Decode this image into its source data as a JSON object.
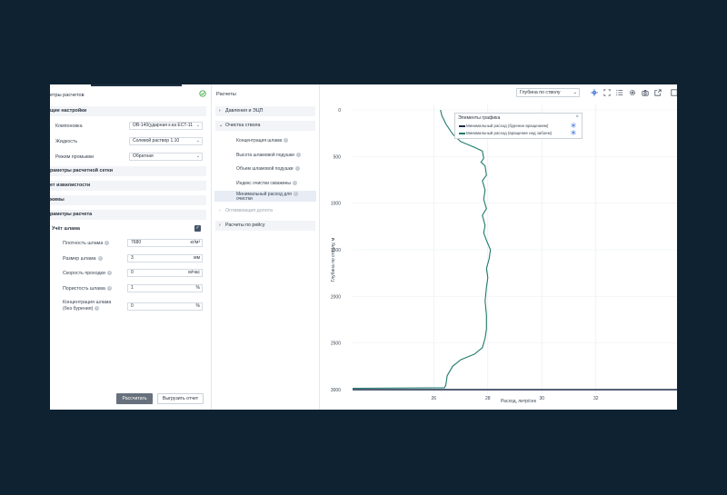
{
  "left_panel": {
    "title": "етры расчетов",
    "sections": {
      "general": "щие настройки",
      "grid": "раметры расчетной сетки",
      "tortuosity": "ет извилистости",
      "modes": "жимы",
      "calc_params": "раметры расчета"
    },
    "fields": {
      "layout_label": "Компоновка",
      "layout_value": "OB-140(ударная к.ка ECT-11",
      "fluid_label": "Жидкость",
      "fluid_value": "Солевой раствор 1.10",
      "flush_label": "Режим промывки",
      "flush_value": "Обратная"
    },
    "sludge": {
      "title": "Учёт шлама",
      "checked": true,
      "density_label": "Плотность шлама",
      "density_value": "7680",
      "density_unit": "кг/м³",
      "size_label": "Размер шлама",
      "size_value": "3",
      "size_unit": "мм",
      "speed_label": "Скорость проходки",
      "speed_value": "0",
      "speed_unit": "м/час",
      "porosity_label": "Пористость шлама",
      "porosity_value": "1",
      "porosity_unit": "%",
      "conc_label_1": "Концентрация шлама",
      "conc_label_2": "(без бурения)",
      "conc_value": "0",
      "conc_unit": "%"
    },
    "buttons": {
      "calculate": "Рассчитать",
      "export": "Выгрузить отчет"
    }
  },
  "middle_panel": {
    "title": "Расчеты",
    "groups": [
      {
        "label": "Давления и ЭЦП",
        "expanded": false
      },
      {
        "label": "Очистка ствола",
        "expanded": true
      },
      {
        "label": "Оптимизация долота",
        "expanded": false
      },
      {
        "label": "Расчеты по рейсу",
        "expanded": false
      }
    ],
    "subitems": [
      "Концентрация шлама",
      "Высота шламовой подушки",
      "Объем шламовой подушки",
      "Индекс очистки скважины"
    ],
    "selected_item_1": "Минимальный расход для",
    "selected_item_2": "очистки"
  },
  "chart_panel": {
    "dropdown": "Глубина по стволу",
    "toolbar_icons": [
      "crosshair-icon",
      "fullscreen-icon",
      "list-icon",
      "settings-icon",
      "camera-icon",
      "export-icon",
      "menu-icon"
    ],
    "legend": {
      "title": "Элементы графика",
      "items": [
        {
          "label": "Минимальный расход (бурение вращением)",
          "color": "#1d2c4a"
        },
        {
          "label": "Минимальный расход (вращение над забоем)",
          "color": "#1e7a6a"
        }
      ]
    }
  },
  "chart_data": {
    "type": "line",
    "xlabel": "Расход, литр/сек",
    "ylabel": "Глубина по стволу, м",
    "xlim": [
      23,
      35
    ],
    "ylim": [
      0,
      3000
    ],
    "y_reversed": true,
    "x_ticks": [
      26,
      28,
      30,
      32
    ],
    "y_ticks": [
      0,
      500,
      1000,
      1500,
      2000,
      2500,
      3000
    ],
    "series": [
      {
        "name": "Минимальный расход (вращение над забоем)",
        "color": "#1e7a6a",
        "points": [
          [
            26.25,
            0
          ],
          [
            26.3,
            60
          ],
          [
            26.45,
            150
          ],
          [
            26.7,
            260
          ],
          [
            27.0,
            340
          ],
          [
            27.5,
            400
          ],
          [
            27.8,
            440
          ],
          [
            27.85,
            520
          ],
          [
            27.75,
            560
          ],
          [
            27.9,
            600
          ],
          [
            27.95,
            700
          ],
          [
            27.8,
            760
          ],
          [
            27.9,
            860
          ],
          [
            27.85,
            960
          ],
          [
            27.95,
            1060
          ],
          [
            27.8,
            1130
          ],
          [
            27.9,
            1240
          ],
          [
            27.85,
            1320
          ],
          [
            27.95,
            1400
          ],
          [
            28.1,
            1500
          ],
          [
            28.05,
            1600
          ],
          [
            27.95,
            1700
          ],
          [
            28.0,
            1800
          ],
          [
            27.95,
            1900
          ],
          [
            27.9,
            2050
          ],
          [
            27.95,
            2200
          ],
          [
            27.95,
            2350
          ],
          [
            27.9,
            2450
          ],
          [
            27.8,
            2550
          ],
          [
            27.5,
            2620
          ],
          [
            27.0,
            2680
          ],
          [
            26.7,
            2750
          ],
          [
            26.5,
            2850
          ],
          [
            26.45,
            2950
          ],
          [
            26.4,
            2980
          ],
          [
            23.0,
            2985
          ]
        ]
      },
      {
        "name": "Минимальный расход (бурение вращением)",
        "color": "#1d2c4a",
        "points": [
          [
            23.0,
            3000
          ],
          [
            35.0,
            3000
          ]
        ]
      }
    ]
  }
}
